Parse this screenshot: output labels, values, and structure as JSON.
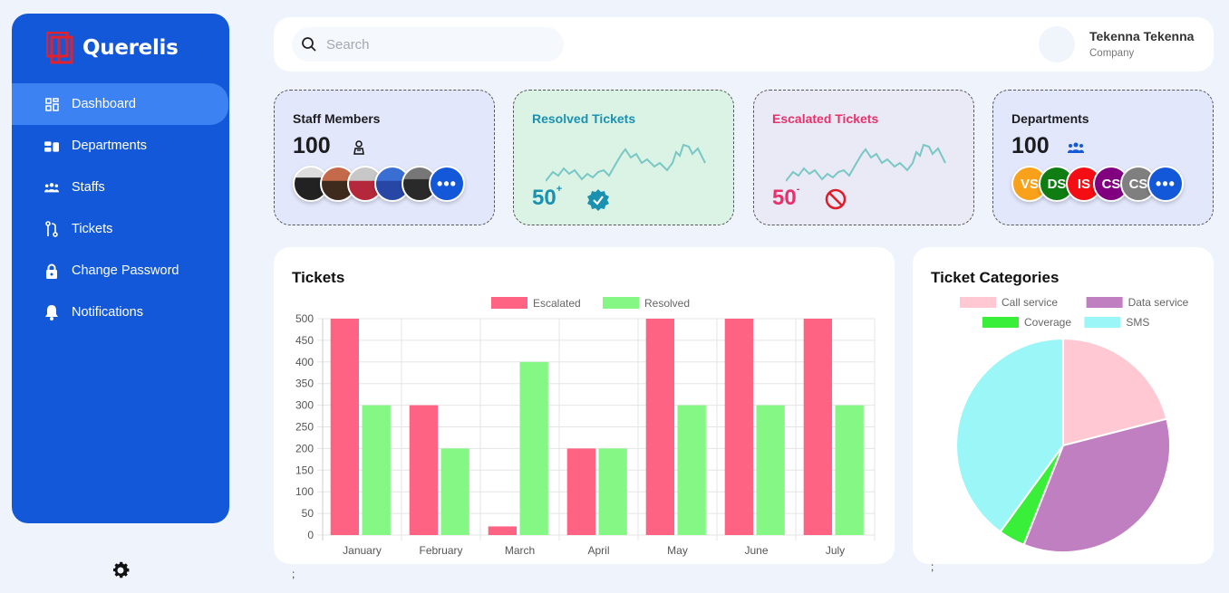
{
  "app": {
    "name": "Querelis"
  },
  "sidebar": {
    "items": [
      {
        "label": "Dashboard",
        "icon": "dashboard-icon",
        "active": true
      },
      {
        "label": "Departments",
        "icon": "departments-icon",
        "active": false
      },
      {
        "label": "Staffs",
        "icon": "staffs-icon",
        "active": false
      },
      {
        "label": "Tickets",
        "icon": "tickets-icon",
        "active": false
      },
      {
        "label": "Change Password",
        "icon": "lock-icon",
        "active": false
      },
      {
        "label": "Notifications",
        "icon": "bell-icon",
        "active": false
      }
    ],
    "settings_icon": "gear-icon"
  },
  "header": {
    "search_placeholder": "Search",
    "user_name": "Tekenna Tekenna",
    "user_role": "Company"
  },
  "cards": {
    "staff": {
      "title": "Staff Members",
      "count": "100",
      "more": "•••"
    },
    "resolved": {
      "title": "Resolved Tickets",
      "count": "50",
      "sup": "+",
      "color": "#1a91b0"
    },
    "escalated": {
      "title": "Escalated Tickets",
      "count": "50",
      "sup": "-",
      "color": "#e8306a"
    },
    "departments": {
      "title": "Departments",
      "count": "100",
      "initials": [
        "VS",
        "DS",
        "IS",
        "CS",
        "CS"
      ],
      "colors": [
        "#f9a11b",
        "#0f7d12",
        "#f40d13",
        "#800080",
        "#7f7f7f"
      ],
      "more": "•••"
    }
  },
  "tickets_chart": {
    "title": "Tickets",
    "chart_data": {
      "type": "bar",
      "categories": [
        "January",
        "February",
        "March",
        "April",
        "May",
        "June",
        "July"
      ],
      "series": [
        {
          "name": "Escalated",
          "values": [
            500,
            300,
            20,
            200,
            500,
            500,
            500
          ],
          "color": "#ff6384"
        },
        {
          "name": "Resolved",
          "values": [
            300,
            200,
            400,
            200,
            300,
            300,
            300
          ],
          "color": "#84f784"
        }
      ],
      "ylim": [
        0,
        500
      ],
      "yticks": [
        0,
        50,
        100,
        150,
        200,
        250,
        300,
        350,
        400,
        450,
        500
      ],
      "legend": "top",
      "grid": true
    }
  },
  "categories_chart": {
    "title": "Ticket Categories",
    "chart_data": {
      "type": "pie",
      "labels": [
        "Call service",
        "Data service",
        "Coverage",
        "SMS"
      ],
      "values": [
        21,
        35,
        4,
        40
      ],
      "colors": [
        "#ffc8d2",
        "#c07fc0",
        "#3aef3a",
        "#9bf7f7"
      ],
      "legend": "top"
    }
  },
  "footer_marks": {
    "left": ";",
    "right": ";"
  }
}
